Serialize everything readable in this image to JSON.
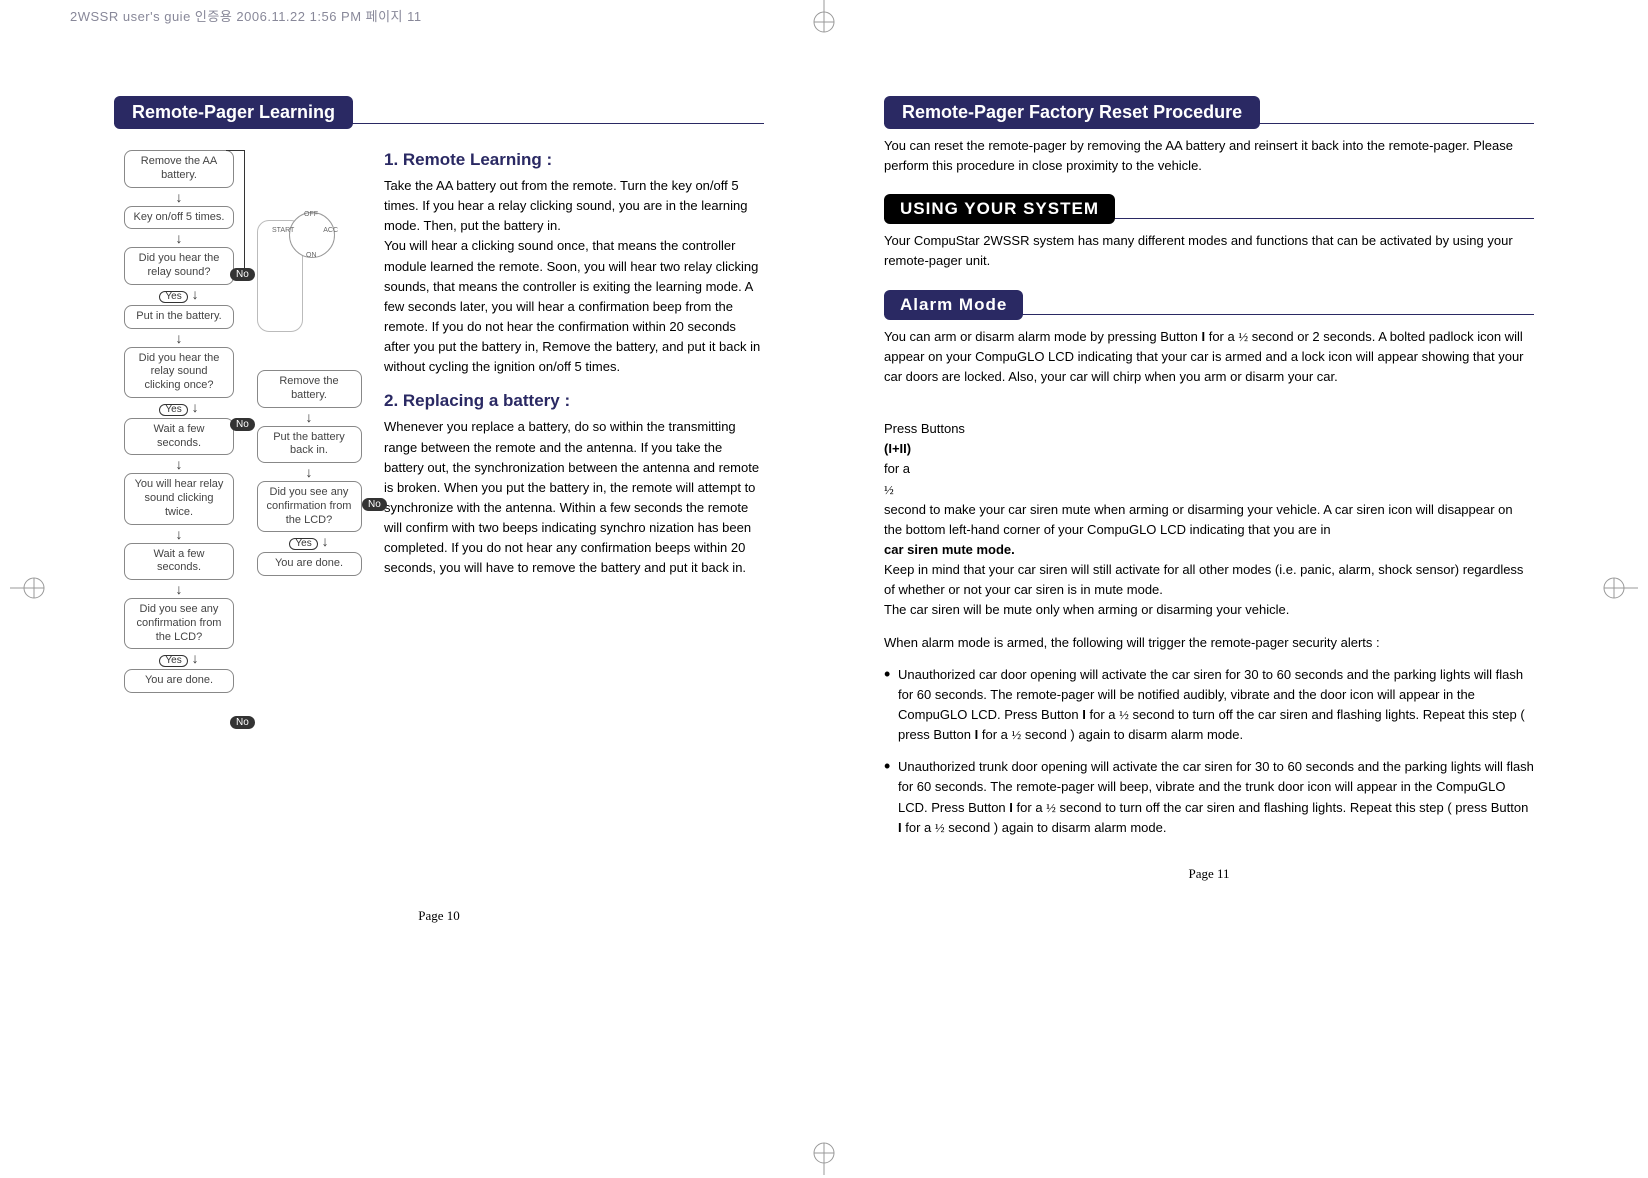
{
  "print_header": "2WSSR user's guie 인증용  2006.11.22 1:56 PM  페이지 11",
  "left": {
    "tab": "Remote-Pager Learning",
    "sub1_title": "1. Remote Learning :",
    "sub1_body": "Take the AA battery out from the remote. Turn the key on/off  5 times.  If you hear a relay clicking sound, you are in the learning mode.  Then, put the battery in.\nYou will hear a clicking sound once, that means the controller module learned the remote.  Soon, you will hear two relay clicking sounds, that means the controller is exiting the learning mode.  A few seconds later, you will hear a confirmation beep from the remote.  If you do not hear the confirmation within  20 seconds after you put the battery in, Remove the battery, and put it back in without cycling the ignition  on/off 5 times.",
    "sub2_title": "2. Replacing a battery :",
    "sub2_body": "Whenever you replace a battery, do so within the transmitting range between the remote and the antenna.  If you take the battery out, the synchronization between the antenna and remote is broken.  When you put the battery in, the remote will attempt to synchronize with the antenna.  Within a few seconds the remote will confirm with two beeps indicating synchro nization has been completed.  If you do not hear any confirmation beeps within 20 seconds, you will have to remove the battery and put it back in.",
    "pagenum": "Page 10",
    "flow": {
      "b1": "Remove the AA battery.",
      "b2": "Key on/off 5 times.",
      "b3": "Did you hear the relay sound?",
      "b4": "Put in the battery.",
      "b5": "Did you hear the relay sound clicking once?",
      "b6": "Wait a few seconds.",
      "b7": "You will hear relay sound clicking twice.",
      "b8": "Wait a few seconds.",
      "b9": "Did you see any confirmation from the LCD?",
      "b10": "You are done.",
      "s1": "Remove the battery.",
      "s2": "Put the battery back in.",
      "s3": "Did you see any confirmation from the LCD?",
      "s4": "You are done.",
      "yes": "Yes",
      "no": "No",
      "dial": {
        "off": "OFF",
        "acc": "ACC",
        "on": "ON",
        "start": "START"
      }
    }
  },
  "right": {
    "tab1": "Remote-Pager Factory Reset Procedure",
    "p1": "You can reset the remote-pager by removing the AA battery and reinsert it back into the remote-pager.  Please perform this procedure in close proximity to the vehicle.",
    "tab2": "USING  YOUR  SYSTEM",
    "p2": "Your CompuStar 2WSSR system has many different modes and functions that can be activated by using your remote-pager unit.",
    "tab3": "Alarm  Mode",
    "p3a": "You can arm or disarm alarm mode by pressing Button",
    "p3b": "for a",
    "p3c": "second or 2 seconds. A bolted padlock icon will appear on your CompuGLO LCD indicating that your car is armed and a lock icon will appear showing that your car doors are locked.  Also, your car will chirp when you arm or disarm your car.",
    "p4a": "Press Buttons",
    "p4b": "for a",
    "p4c": "second to make your car siren mute when arming or disarming your vehicle.  A car siren icon will disappear on the bottom left-hand corner of your CompuGLO LCD indicating that you are in",
    "p4d": "car siren mute mode.",
    "p4e": "Keep in mind that your car siren will still activate for all other modes (i.e. panic, alarm, shock sensor) regardless of whether or not your car siren is in mute mode.\nThe car siren will be mute only when arming or disarming your vehicle.",
    "p5": "When alarm mode is armed, the following will trigger the remote-pager security alerts :",
    "li1a": "Unauthorized car door opening will activate the car siren for 30 to 60 seconds and the parking lights will flash for 60 seconds. The remote-pager will be notified audibly, vibrate and the door icon will appear in the CompuGLO LCD. Press Button ",
    "li1b": " for a",
    "li1c": "second to turn off the car siren and flashing lights.  Repeat this step ( press Button",
    "li1d": "for a",
    "li1e": "second ) again to disarm alarm mode.",
    "li2a": "Unauthorized trunk door opening will activate the car siren for 30 to 60 seconds and the parking lights will flash for 60 seconds. The remote-pager will beep, vibrate and the trunk door icon will appear in the CompuGLO LCD.  Press Button",
    "li2b": "for a",
    "li2c": "second to turn off the car siren and flashing lights. Repeat this step ( press Button",
    "li2d": "for a",
    "li2e": "second ) again to disarm alarm mode.",
    "btn_i": "I",
    "btn_i_ii": "(I+II)",
    "half": "½",
    "pagenum": "Page 11"
  }
}
